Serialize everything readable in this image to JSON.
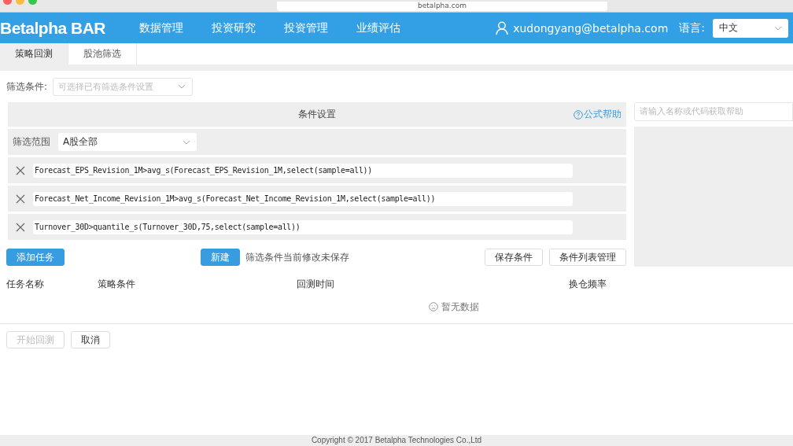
{
  "browser": {
    "url": "betalpha.com"
  },
  "header": {
    "logo": "Betalpha BAR",
    "nav": [
      {
        "label": "数据管理"
      },
      {
        "label": "投资研究"
      },
      {
        "label": "投资管理"
      },
      {
        "label": "业绩评估"
      }
    ],
    "user": "xudongyang@betalpha.com",
    "language_label": "语言:",
    "language_value": "中文"
  },
  "tabs": [
    {
      "label": "策略回测",
      "selected": true
    },
    {
      "label": "股池筛选",
      "selected": false
    }
  ],
  "filter": {
    "label": "筛选条件:",
    "placeholder": "可选择已有筛选条件设置"
  },
  "conditions": {
    "title": "条件设置",
    "help": "公式帮助",
    "range_label": "筛选范围",
    "range_value": "A股全部",
    "items": [
      {
        "text": "Forecast_EPS_Revision_1M>avg_s(Forecast_EPS_Revision_1M,select(sample=all))"
      },
      {
        "text": "Forecast_Net_Income_Revision_1M>avg_s(Forecast_Net_Income_Revision_1M,select(sample=all))"
      },
      {
        "text": "Turnover_30D>quantile_s(Turnover_30D,75,select(sample=all))"
      }
    ]
  },
  "help_panel": {
    "placeholder": "请输入名称或代码获取帮助"
  },
  "actions": {
    "add_task": "添加任务",
    "new": "新建",
    "status": "筛选条件当前修改未保存",
    "save": "保存条件",
    "manage": "条件列表管理"
  },
  "table": {
    "columns": [
      "任务名称",
      "策略条件",
      "回测时间",
      "换仓频率"
    ],
    "empty": "暂无数据"
  },
  "bottom_buttons": [
    {
      "label": "开始回测",
      "disabled": true
    },
    {
      "label": "取消",
      "disabled": false
    }
  ],
  "footer": "Copyright © 2017 Betalpha Technologies Co.,Ltd"
}
